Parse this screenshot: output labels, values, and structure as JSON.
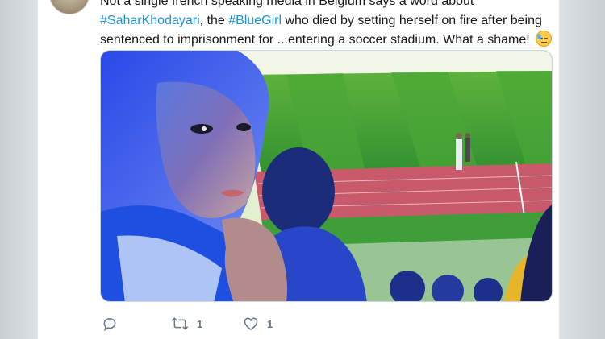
{
  "tweet": {
    "cut_line": "Not a single french speaking media in Belgium says a word about",
    "hashtag_1": "#SaharKhodayari",
    "text_1": ", the ",
    "hashtag_2": "#BlueGirl",
    "text_2": " who died by setting herself on fire after being",
    "line_3": "sentenced to imprisonment for ...entering a soccer stadium. What a shame!",
    "emoji": "downcast-face-with-sweat"
  },
  "media": {
    "description_icon": "photo",
    "colors": {
      "field": "#3a9a3c",
      "track": "#c44a5e",
      "jersey": "#1d4fd6"
    }
  },
  "actions": {
    "reply": {
      "icon": "reply-icon",
      "count": ""
    },
    "retweet": {
      "icon": "retweet-icon",
      "count": "1"
    },
    "like": {
      "icon": "heart-icon",
      "count": "1"
    }
  },
  "colors": {
    "link": "#1b95e0",
    "text": "#14171a",
    "muted": "#657786"
  }
}
